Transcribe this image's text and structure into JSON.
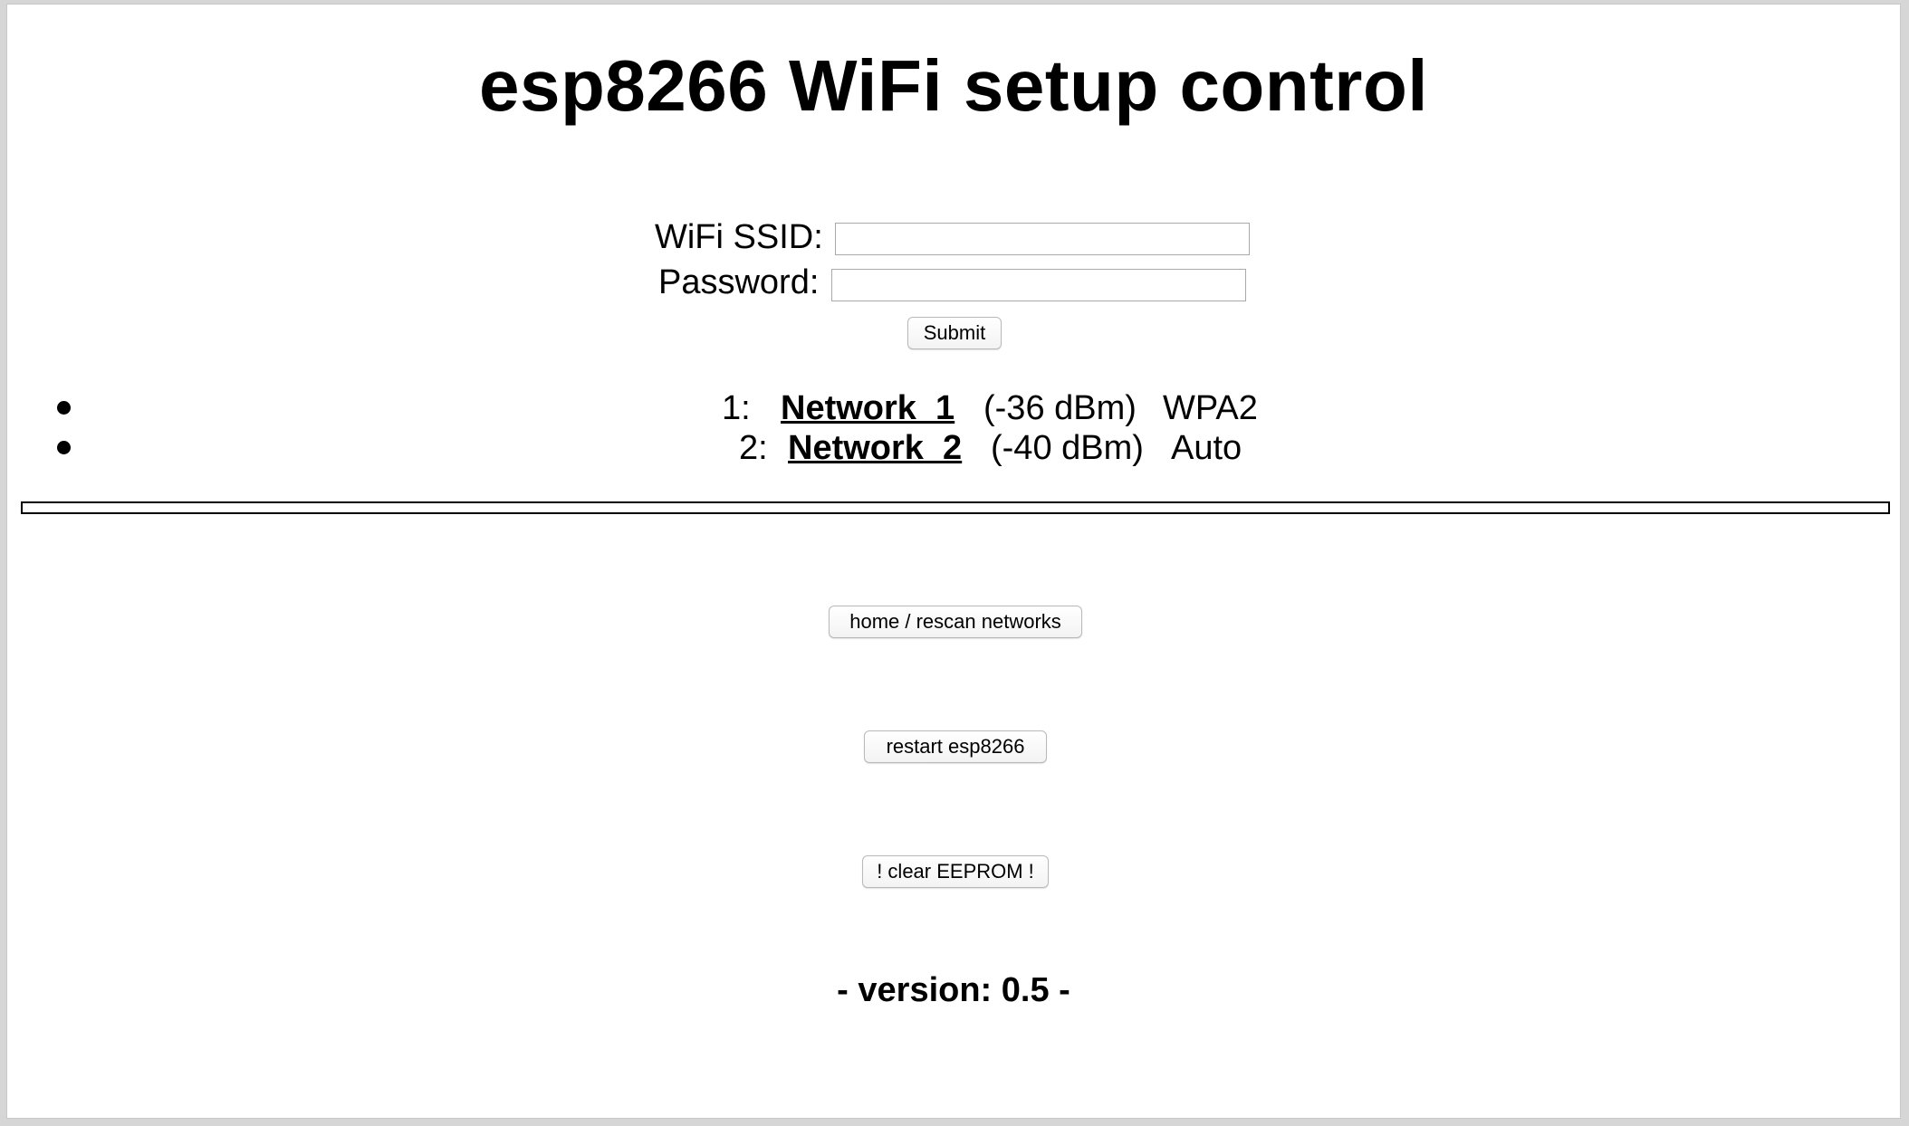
{
  "page": {
    "title": "esp8266 WiFi setup control"
  },
  "form": {
    "ssid_label": "WiFi SSID:",
    "ssid_value": "",
    "password_label": "Password:",
    "password_value": "",
    "submit_label": "Submit"
  },
  "networks": [
    {
      "index": "1:",
      "ssid": "Network_1",
      "signal": "(-36 dBm)",
      "security": "WPA2"
    },
    {
      "index": "2:",
      "ssid": "Network_2",
      "signal": "(-40 dBm)",
      "security": "Auto"
    }
  ],
  "actions": {
    "home_label": "home / rescan networks",
    "restart_label": "restart esp8266",
    "clear_label": "! clear EEPROM !"
  },
  "footer": {
    "version": "- version: 0.5 -"
  }
}
